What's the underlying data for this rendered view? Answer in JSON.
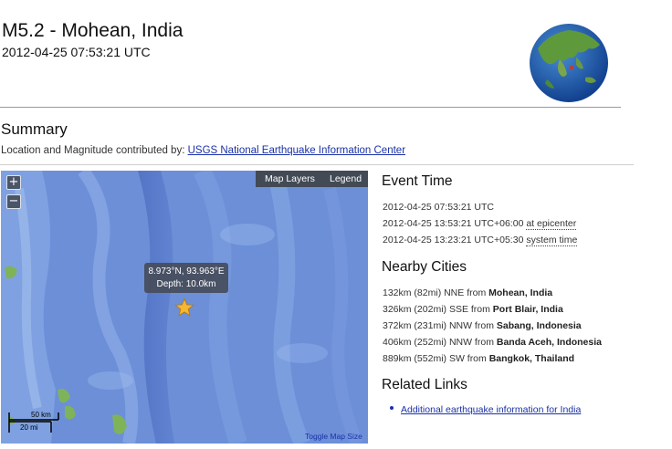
{
  "header": {
    "title": "M5.2 - Mohean, India",
    "datetime": "2012-04-25 07:53:21 UTC"
  },
  "summary": {
    "heading": "Summary",
    "contrib_label": "Location and Magnitude contributed by:",
    "contrib_link": "USGS National Earthquake Information Center"
  },
  "map": {
    "zoom_in": "+",
    "zoom_out": "−",
    "map_layers": "Map Layers",
    "legend": "Legend",
    "popup_coords": "8.973°N, 93.963°E",
    "popup_depth": "Depth: 10.0km",
    "scale_km": "50 km",
    "scale_mi": "20 mi",
    "toggle_size": "Toggle Map Size",
    "marker_icon": "star-icon",
    "water_color": "#6c8fd8",
    "land_color": "#7fb35a"
  },
  "event_time": {
    "heading": "Event Time",
    "utc": "2012-04-25 07:53:21 UTC",
    "epicenter_time": "2012-04-25 13:53:21 UTC+06:00",
    "epicenter_label": "at epicenter",
    "system_time": "2012-04-25 13:23:21 UTC+05:30",
    "system_label": "system time"
  },
  "nearby": {
    "heading": "Nearby Cities",
    "cities": [
      {
        "dist": "132km (82mi) NNE from",
        "place": "Mohean, India"
      },
      {
        "dist": "326km (202mi) SSE from",
        "place": "Port Blair, India"
      },
      {
        "dist": "372km (231mi) NNW from",
        "place": "Sabang, Indonesia"
      },
      {
        "dist": "406km (252mi) NNW from",
        "place": "Banda Aceh, Indonesia"
      },
      {
        "dist": "889km (552mi) SW from",
        "place": "Bangkok, Thailand"
      }
    ]
  },
  "related": {
    "heading": "Related Links",
    "links": [
      "Additional earthquake information for India"
    ]
  }
}
